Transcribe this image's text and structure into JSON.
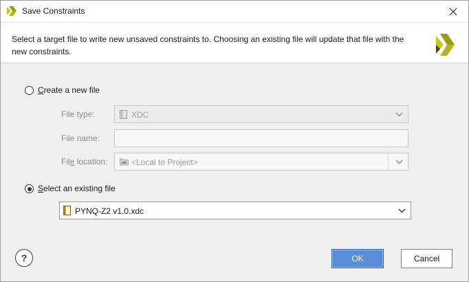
{
  "window": {
    "title": "Save Constraints",
    "close_icon": "close-icon",
    "logo_icon": "vivado-logo-icon"
  },
  "header": {
    "message": "Select a target file to write new unsaved constraints to. Choosing an existing file will update that file with the new constraints."
  },
  "create_new": {
    "label_mnemonic": "C",
    "label_rest": "reate a new file",
    "selected": false,
    "file_type": {
      "label": "File type:",
      "value": "XDC",
      "enabled": false
    },
    "file_name": {
      "label": "File name:",
      "value": "",
      "enabled": false
    },
    "file_location": {
      "label_pre": "Fil",
      "label_mnemonic": "e",
      "label_post": " location:",
      "value": "<Local to Project>",
      "enabled": false
    }
  },
  "select_existing": {
    "label_mnemonic": "S",
    "label_rest": "elect an existing file",
    "selected": true,
    "file": "PYNQ-Z2 v1.0.xdc"
  },
  "footer": {
    "help_label": "?",
    "ok_label": "OK",
    "cancel_label": "Cancel"
  },
  "colors": {
    "accent": "#5b8cd7",
    "logo_yellow": "#b5b520",
    "logo_dark": "#4a4a10"
  }
}
